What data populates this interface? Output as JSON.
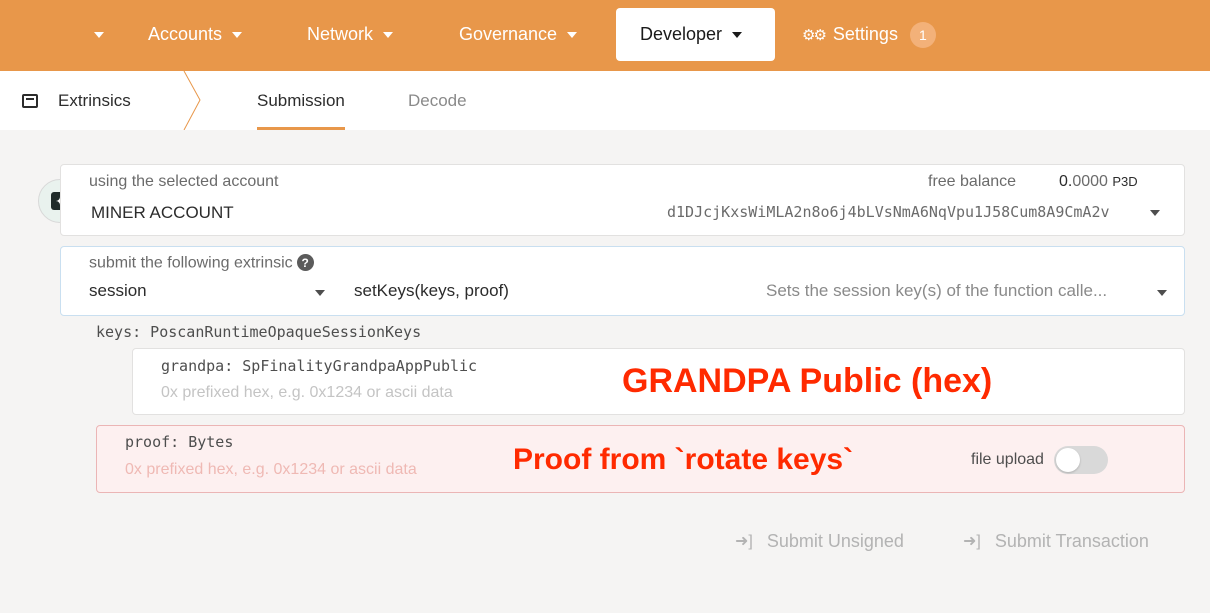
{
  "nav": {
    "items": [
      {
        "label": "Accounts"
      },
      {
        "label": "Network"
      },
      {
        "label": "Governance"
      },
      {
        "label": "Developer"
      },
      {
        "label": "Settings",
        "badge": "1"
      }
    ]
  },
  "subnav": {
    "section": "Extrinsics",
    "tabs": [
      {
        "label": "Submission"
      },
      {
        "label": "Decode"
      }
    ]
  },
  "account": {
    "label": "using the selected account",
    "name": "MINER ACCOUNT",
    "balance_label": "free balance",
    "balance_int": "0.",
    "balance_dec": "0000",
    "balance_unit": "P3D",
    "address": "d1DJcjKxsWiMLA2n8o6j4bLVsNmA6NqVpu1J58Cum8A9CmA2v"
  },
  "extrinsic": {
    "label": "submit the following extrinsic",
    "module": "session",
    "method": "setKeys(keys, proof)",
    "description": "Sets the session key(s) of the function calle..."
  },
  "params": {
    "keys_label": "keys: PoscanRuntimeOpaqueSessionKeys",
    "grandpa_label": "grandpa: SpFinalityGrandpaAppPublic",
    "grandpa_placeholder": "0x prefixed hex, e.g. 0x1234 or ascii data",
    "proof_label": "proof: Bytes",
    "proof_placeholder": "0x prefixed hex, e.g. 0x1234 or ascii data",
    "file_upload": "file upload"
  },
  "annotations": {
    "grandpa": "GRANDPA Public (hex)",
    "proof": "Proof from `rotate keys`"
  },
  "actions": {
    "unsigned": "Submit Unsigned",
    "transaction": "Submit Transaction"
  },
  "colors": {
    "accent": "#e8974a",
    "annotation": "#ff2a00",
    "error_bg": "#fdf0f0"
  }
}
